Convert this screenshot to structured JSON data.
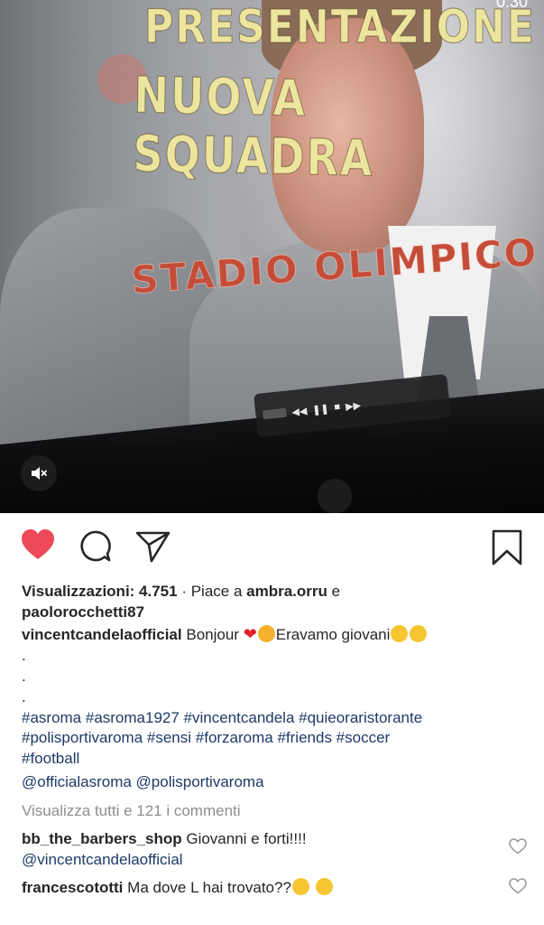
{
  "video": {
    "overlay_line1": "PRESENTAZIONE",
    "overlay_line2": "NUOVA SQUADRA",
    "overlay_line3": "STADIO OLIMPICO",
    "corner_time": "0:30",
    "mute_icon": "speaker-muted-icon"
  },
  "actions": {
    "like_icon": "heart-filled-icon",
    "like_color": "#ed4956",
    "comment_icon": "comment-bubble-icon",
    "share_icon": "paper-plane-icon",
    "save_icon": "bookmark-icon"
  },
  "stats": {
    "views_label": "Visualizzazioni: 4.751",
    "separator": " · Piace a ",
    "liker1": "ambra.orru",
    "connector": " e",
    "liker2": "paolorocchetti87"
  },
  "caption": {
    "username": "vincentcandelaofficial",
    "text_start": "Bonjour",
    "text_mid": "Eravamo giovani",
    "dots": [
      ".",
      ".",
      "."
    ],
    "hashtags_line1": "#asroma #asroma1927 #vincentcandela #quieoraristorante",
    "hashtags_line2": "#polisportivaroma #sensi #forzaroma #friends #soccer",
    "hashtags_line3": "#football",
    "mentions": "@officialasroma @polisportivaroma"
  },
  "view_all_comments": "Visualizza tutti e 121 i commenti",
  "comments": [
    {
      "username": "bb_the_barbers_shop",
      "text": "Giovanni e forti!!!!",
      "mention": "@vincentcandelaofficial"
    },
    {
      "username": "francescototti",
      "text": "Ma dove L hai trovato??"
    }
  ]
}
